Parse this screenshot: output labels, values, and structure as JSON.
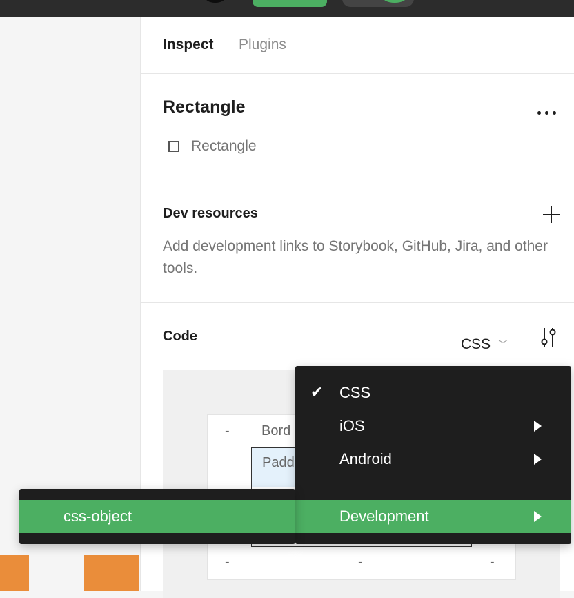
{
  "tabs": {
    "inspect": "Inspect",
    "plugins": "Plugins"
  },
  "layer": {
    "title": "Rectangle",
    "type_label": "Rectangle"
  },
  "dev_resources": {
    "title": "Dev resources",
    "description": "Add development links to Storybook, GitHub, Jira, and other tools."
  },
  "code": {
    "title": "Code",
    "language": "CSS",
    "box_model": {
      "border_label": "Bord",
      "padding_label": "Padd",
      "dash": "-"
    }
  },
  "language_menu": {
    "items": [
      {
        "label": "CSS",
        "checked": true,
        "has_submenu": false
      },
      {
        "label": "iOS",
        "checked": false,
        "has_submenu": true
      },
      {
        "label": "Android",
        "checked": false,
        "has_submenu": true
      },
      {
        "label": "Development",
        "checked": false,
        "has_submenu": true,
        "highlighted": true
      }
    ],
    "check_glyph": "✔"
  },
  "submenu": {
    "items": [
      {
        "label": "css-object",
        "highlighted": true
      }
    ]
  },
  "colors": {
    "accent": "#4caf62",
    "menu_bg": "#1e1e1e",
    "canvas_shape": "#ea8d3a"
  }
}
